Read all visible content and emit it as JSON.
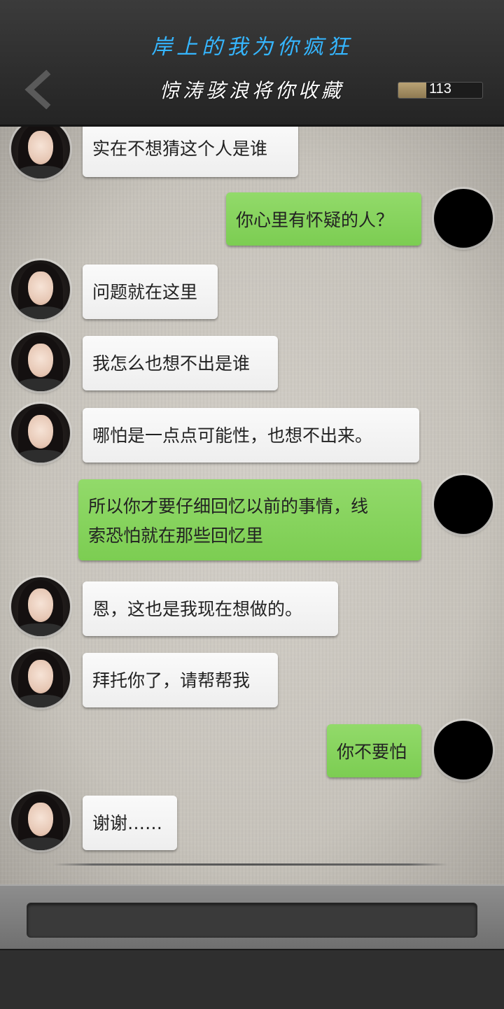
{
  "header": {
    "top_title": "岸上的我为你疯狂",
    "sub_title": "惊涛骇浪将你收藏",
    "progress_value": "113",
    "progress_fraction": 0.33
  },
  "messages": [
    {
      "side": "left",
      "text": "实在不想猜这个人是谁"
    },
    {
      "side": "right",
      "text": "你心里有怀疑的人？"
    },
    {
      "side": "left",
      "text": "问题就在这里"
    },
    {
      "side": "left",
      "text": "我怎么也想不出是谁"
    },
    {
      "side": "left",
      "text": "哪怕是一点点可能性，也想不出来。"
    },
    {
      "side": "right",
      "text": "所以你才要仔细回忆以前的事情，线",
      "text2": "索恐怕就在那些回忆里"
    },
    {
      "side": "left",
      "text": "恩，这也是我现在想做的。"
    },
    {
      "side": "left",
      "text": "拜托你了，请帮帮我"
    },
    {
      "side": "right",
      "text": "你不要怕"
    },
    {
      "side": "left",
      "text": "谢谢……"
    }
  ],
  "input": {
    "placeholder": ""
  },
  "icons": {
    "back": "back-arrow-icon"
  }
}
